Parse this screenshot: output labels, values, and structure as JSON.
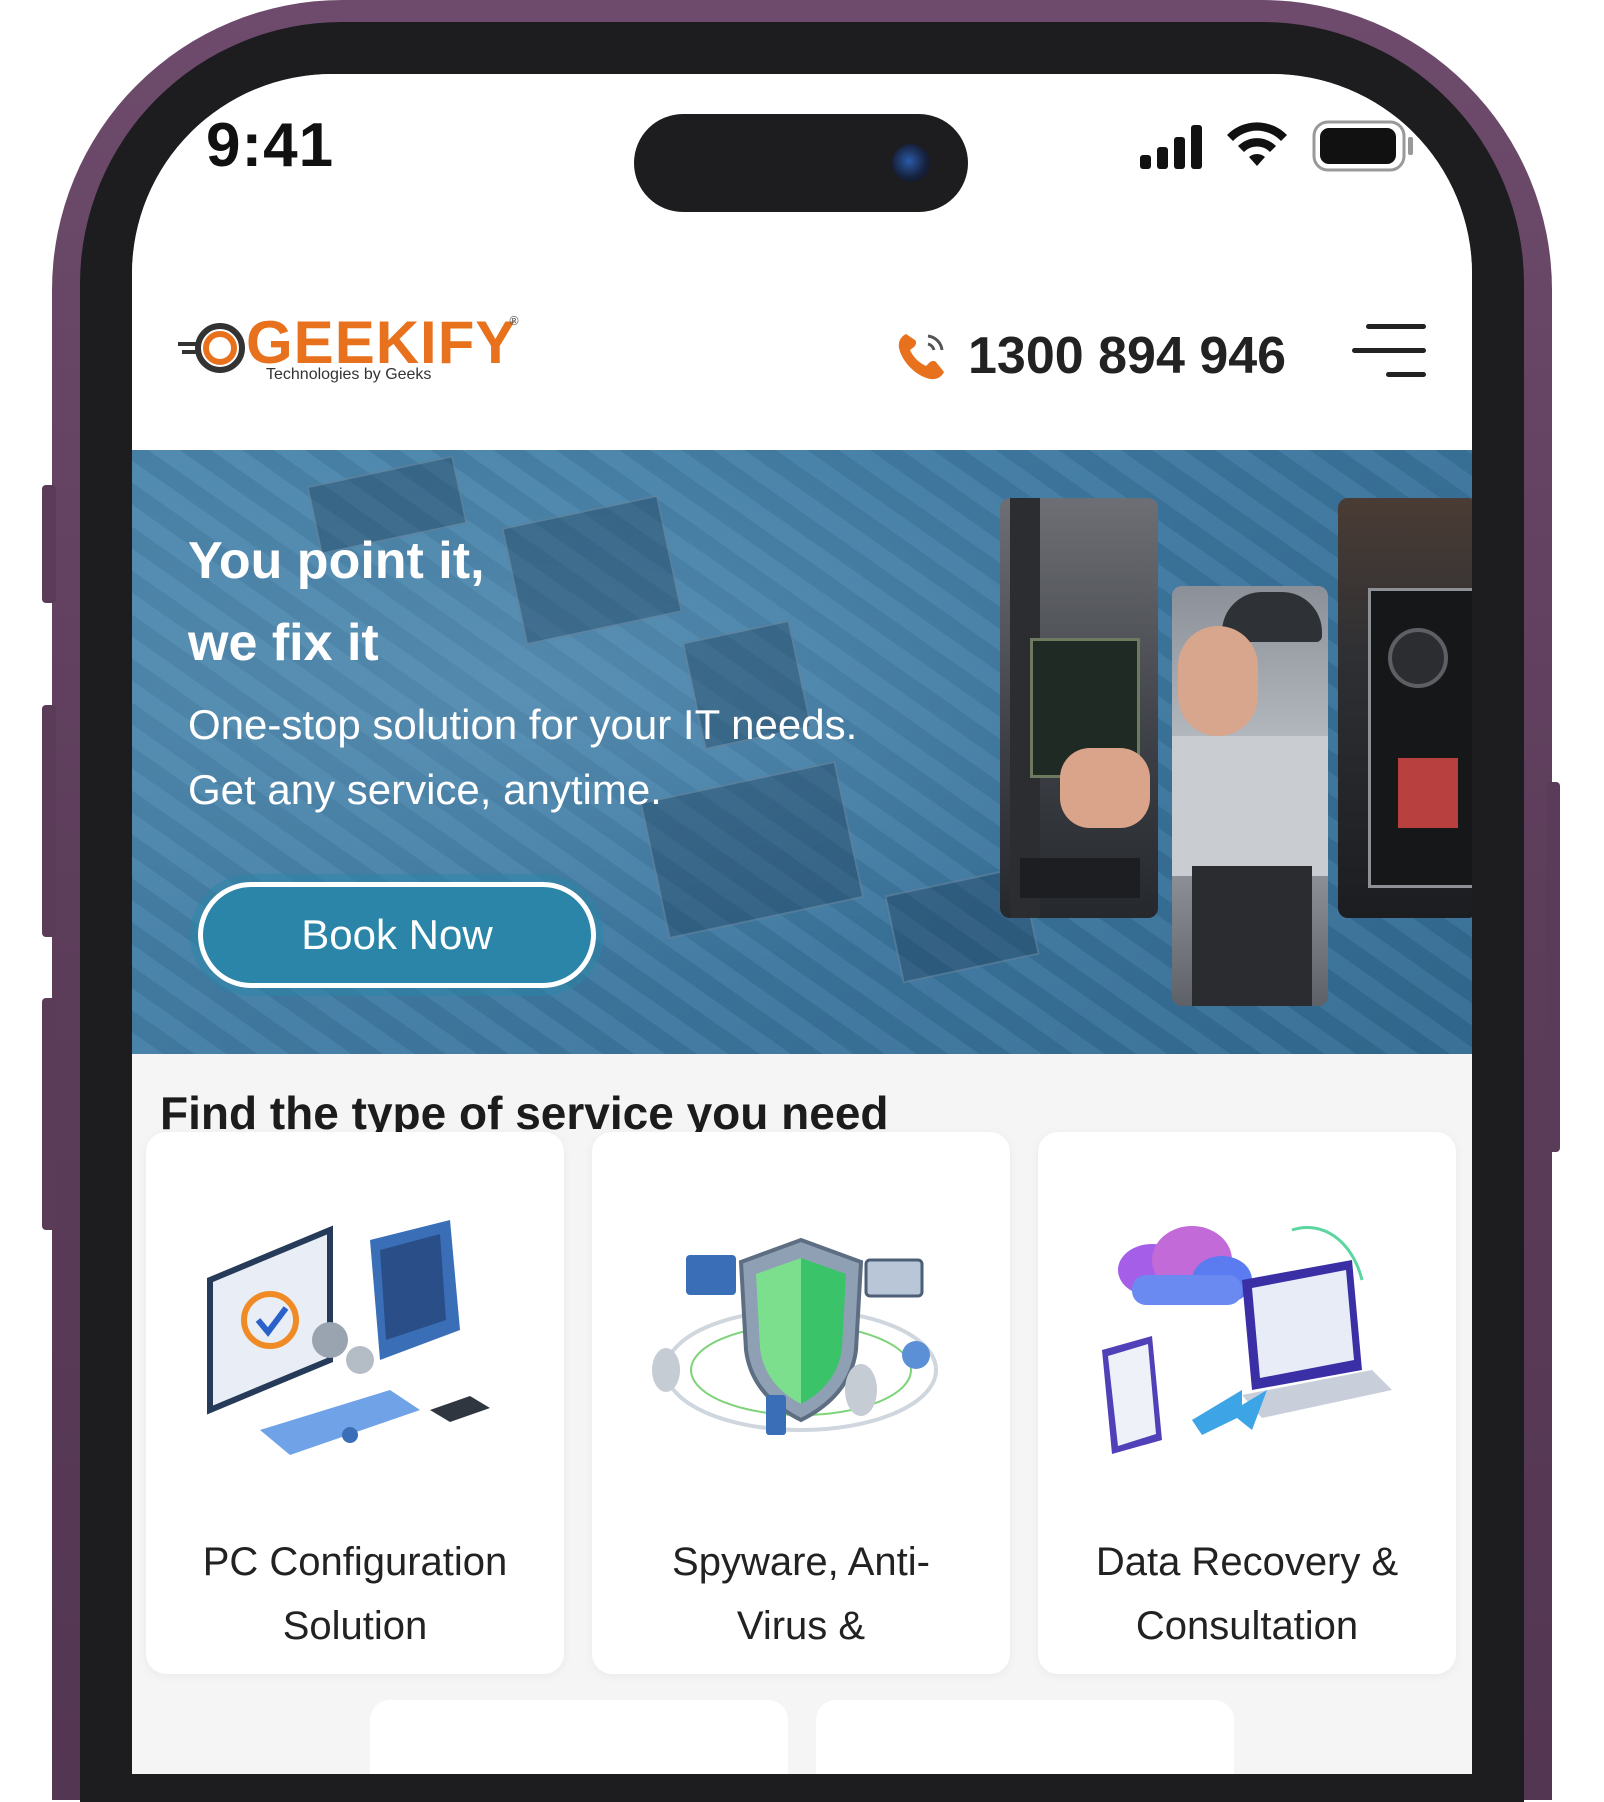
{
  "status_bar": {
    "time": "9:41"
  },
  "header": {
    "logo_text": "GEEKIFY",
    "logo_tagline": "Technologies by Geeks",
    "logo_registered": "®",
    "phone_number": "1300 894 946",
    "icons": [
      "phone-icon",
      "hamburger-menu-icon"
    ]
  },
  "hero": {
    "title_line1": "You point it,",
    "title_line2": "we fix it",
    "subtitle_line1": "One-stop solution for your IT needs.",
    "subtitle_line2": "Get any service, anytime.",
    "cta_label": "Book Now"
  },
  "services": {
    "heading": "Find the type of service you need",
    "cards": [
      {
        "line1": "PC Configuration",
        "line2": "Solution",
        "icon": "pc-configuration-illustration"
      },
      {
        "line1": "Spyware, Anti-",
        "line2": "Virus &",
        "icon": "security-shield-illustration"
      },
      {
        "line1": "Data Recovery &",
        "line2": "Consultation",
        "icon": "cloud-data-recovery-illustration"
      }
    ]
  },
  "colors": {
    "brand_orange": "#e8711d",
    "hero_blue": "#3f7aa3",
    "cta_teal": "#2a85a8",
    "frame_purple": "#5c3d5a"
  }
}
